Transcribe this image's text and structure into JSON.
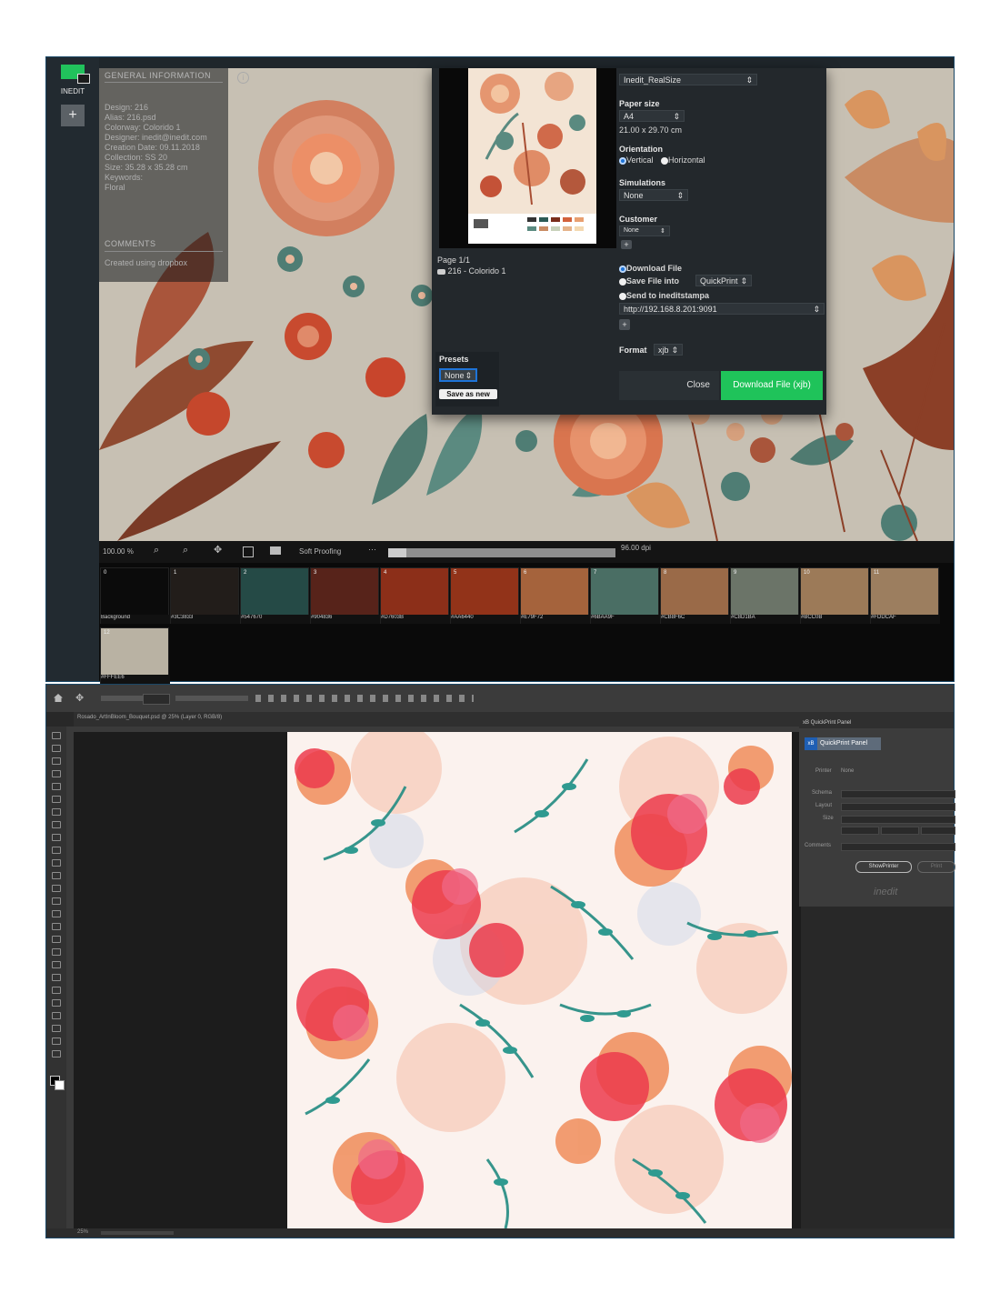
{
  "inedit": {
    "logo_label": "INEDIT",
    "general_info": {
      "title": "GENERAL INFORMATION",
      "lines": [
        "Design: 216",
        "Alias: 216.psd",
        "Colorway: Colorido 1",
        "Designer: inedit@inedit.com",
        "Creation Date: 09.11.2018",
        "Collection: SS 20",
        "Size: 35.28 x 35.28 cm",
        "Keywords:",
        "Floral"
      ],
      "comments_title": "COMMENTS",
      "comments_text": "Created using dropbox"
    },
    "dialog": {
      "profile_value": "Inedit_RealSize",
      "paper_size_label": "Paper size",
      "paper_size_value": "A4",
      "paper_dims": "21.00 x 29.70 cm",
      "orientation_label": "Orientation",
      "vertical_label": "Vertical",
      "horizontal_label": "Horizontal",
      "simulations_label": "Simulations",
      "simulations_value": "None",
      "customer_label": "Customer",
      "customer_value": "None",
      "page_info": "Page 1/1",
      "page_item": "216 - Colorido 1",
      "download_file_label": "Download File",
      "save_file_into_label": "Save File into",
      "quickprint_value": "QuickPrint",
      "send_to_label": "Send to ineditstampa",
      "url_value": "http://192.168.8.201:9091",
      "format_label": "Format",
      "format_value": "xjb",
      "presets_label": "Presets",
      "presets_value": "None",
      "save_as_new": "Save as new",
      "close_button": "Close",
      "download_button": "Download File (xjb)"
    },
    "toolbar": {
      "zoom": "100.00 %",
      "soft_proofing": "Soft Proofing",
      "dpi": "96.00 dpi"
    },
    "palette": [
      {
        "num": "0",
        "label": "Background",
        "color": "#0b0b0b"
      },
      {
        "num": "1",
        "label": "#3C3833",
        "color": "#221d1a"
      },
      {
        "num": "2",
        "label": "#547670",
        "color": "#254a46"
      },
      {
        "num": "3",
        "label": "#904836",
        "color": "#57231a"
      },
      {
        "num": "4",
        "label": "#D7603B",
        "color": "#8c2f19"
      },
      {
        "num": "5",
        "label": "#AA6440",
        "color": "#923319"
      },
      {
        "num": "6",
        "label": "#E79F72",
        "color": "#a5633c"
      },
      {
        "num": "7",
        "label": "#6BAA9F",
        "color": "#4a6e64"
      },
      {
        "num": "8",
        "label": "#CB8F6C",
        "color": "#9a6a48"
      },
      {
        "num": "9",
        "label": "#C8D1BA",
        "color": "#6b7468"
      },
      {
        "num": "10",
        "label": "#BCC0B",
        "color": "#9c7a58"
      },
      {
        "num": "11",
        "label": "#FDDCAF",
        "color": "#9c7e5f"
      },
      {
        "num": "12",
        "label": "#FFFEE6",
        "color": "#b9b2a3"
      }
    ]
  },
  "photoshop": {
    "doc_tab": "Rosado_ArtInBloom_Bouquet.psd @ 25% (Layer 0, RGB/8)",
    "panel_title": "xB QuickPrint Panel",
    "panel_tab": "QuickPrint Panel",
    "fields": {
      "printer_label": "Printer",
      "printer_value": "None",
      "schema_label": "Schema",
      "layout_label": "Layout",
      "size_label": "Size",
      "comments_label": "Comments"
    },
    "preview_button": "ShowPrinter",
    "print_button": "Print",
    "brand": "inedit",
    "status_zoom": "25%"
  }
}
